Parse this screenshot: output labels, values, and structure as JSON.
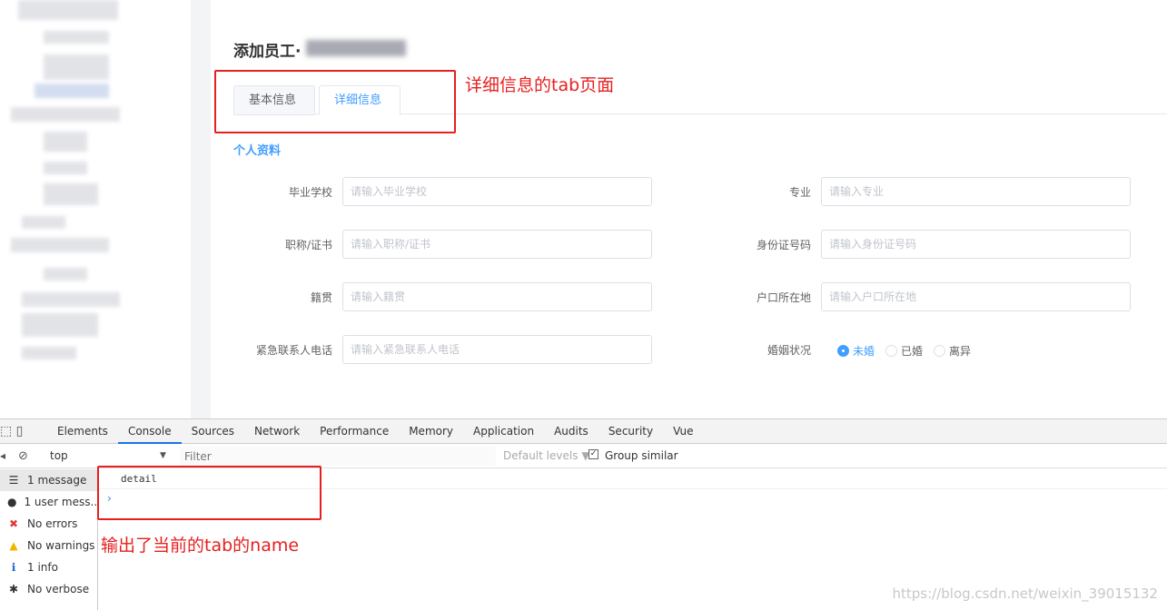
{
  "page": {
    "title": "添加员工·",
    "tabs": [
      {
        "label": "基本信息",
        "name": "basic"
      },
      {
        "label": "详细信息",
        "name": "detail",
        "active": true
      }
    ],
    "section": "个人资料"
  },
  "form": {
    "left": [
      {
        "label": "毕业学校",
        "placeholder": "请输入毕业学校"
      },
      {
        "label": "职称/证书",
        "placeholder": "请输入职称/证书"
      },
      {
        "label": "籍贯",
        "placeholder": "请输入籍贯"
      },
      {
        "label": "紧急联系人电话",
        "placeholder": "请输入紧急联系人电话"
      }
    ],
    "right": [
      {
        "label": "专业",
        "placeholder": "请输入专业"
      },
      {
        "label": "身份证号码",
        "placeholder": "请输入身份证号码"
      },
      {
        "label": "户口所在地",
        "placeholder": "请输入户口所在地"
      }
    ],
    "marital": {
      "label": "婚姻状况",
      "options": [
        "未婚",
        "已婚",
        "离异"
      ],
      "selected": "未婚"
    }
  },
  "annotations": {
    "tab_note": "详细信息的tab页面",
    "console_note": "输出了当前的tab的name"
  },
  "devtools": {
    "tabs": [
      "Elements",
      "Console",
      "Sources",
      "Network",
      "Performance",
      "Memory",
      "Application",
      "Audits",
      "Security",
      "Vue"
    ],
    "active_tab": "Console",
    "context": "top",
    "filter_placeholder": "Filter",
    "levels": "Default levels ▼",
    "group_similar": "Group similar",
    "sidebar": [
      {
        "icon": "list-icon",
        "glyph": "☰",
        "label": "1 message",
        "color": "#333"
      },
      {
        "icon": "user-icon",
        "glyph": "●",
        "label": "1 user mess...",
        "color": "#333"
      },
      {
        "icon": "error-icon",
        "glyph": "✖",
        "label": "No errors",
        "color": "#e03c3c"
      },
      {
        "icon": "warning-icon",
        "glyph": "▲",
        "label": "No warnings",
        "color": "#f0b400"
      },
      {
        "icon": "info-icon",
        "glyph": "ℹ",
        "label": "1 info",
        "color": "#1a5fd8"
      },
      {
        "icon": "bug-icon",
        "glyph": "✱",
        "label": "No verbose",
        "color": "#333"
      }
    ],
    "messages": [
      "detail"
    ],
    "prompt": "›"
  },
  "watermark": "https://blog.csdn.net/weixin_39015132",
  "colors": {
    "accent": "#409eff",
    "annotation": "#e5201f"
  }
}
